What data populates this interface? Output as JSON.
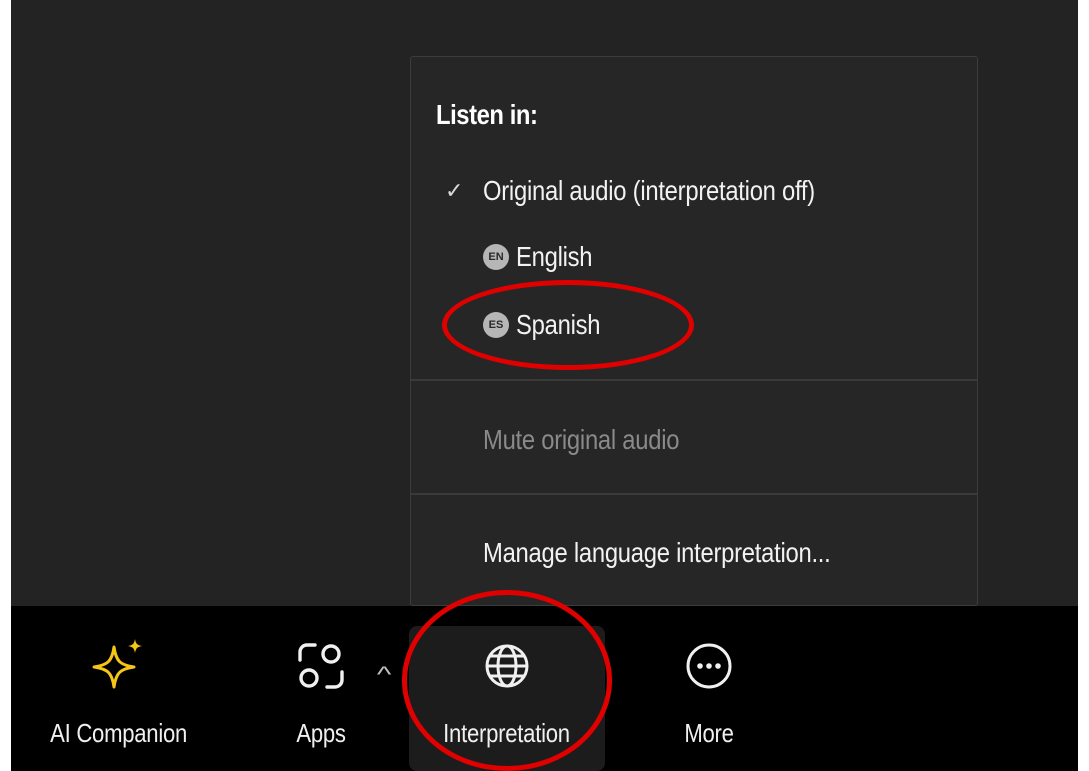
{
  "menu": {
    "heading": "Listen in:",
    "check_glyph": "✓",
    "original_audio": "Original audio (interpretation off)",
    "languages": [
      {
        "code": "EN",
        "label": "English"
      },
      {
        "code": "ES",
        "label": "Spanish"
      }
    ],
    "mute_original": "Mute original audio",
    "manage": "Manage language interpretation..."
  },
  "toolbar": {
    "ai_companion": "AI Companion",
    "apps": "Apps",
    "apps_caret": "^",
    "interpretation": "Interpretation",
    "more": "More"
  },
  "icons": {
    "ai_companion": "sparkle-icon",
    "apps": "apps-icon",
    "interpretation": "globe-icon",
    "more": "more-ellipsis-icon"
  },
  "colors": {
    "ai_accent": "#f5c518",
    "annotation": "#e00000",
    "background": "#232323",
    "toolbar": "#000000"
  }
}
